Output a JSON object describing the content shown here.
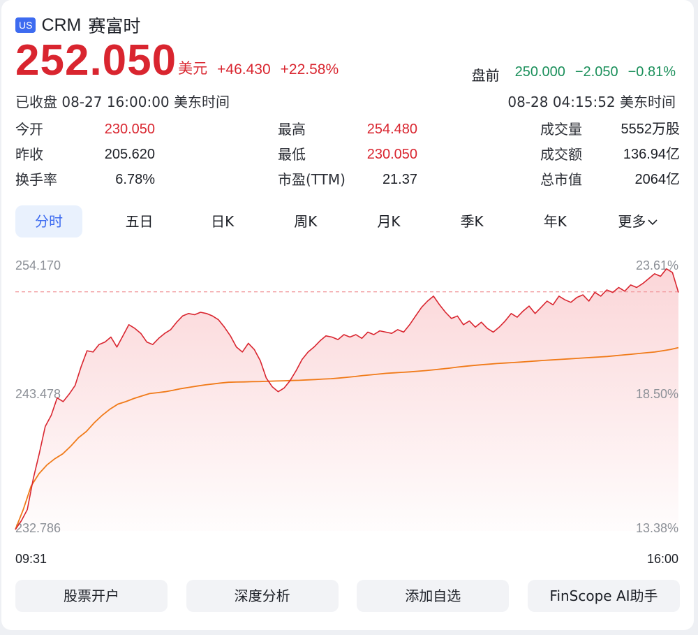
{
  "header": {
    "market_badge": "US",
    "ticker": "CRM",
    "name": "赛富时",
    "price": "252.050",
    "currency": "美元",
    "change": "+46.430",
    "change_pct": "+22.58%",
    "premarket_label": "盘前",
    "premarket_price": "250.000",
    "premarket_change": "−2.050",
    "premarket_pct": "−0.81%",
    "close_status": "已收盘 08-27 16:00:00 美东时间",
    "premarket_time": "08-28 04:15:52 美东时间"
  },
  "stats": {
    "col1": [
      {
        "label": "今开",
        "value": "230.050"
      },
      {
        "label": "昨收",
        "value": "205.620"
      },
      {
        "label": "换手率",
        "value": "6.78%"
      }
    ],
    "col2": [
      {
        "label": "最高",
        "value": "254.480"
      },
      {
        "label": "最低",
        "value": "230.050"
      },
      {
        "label": "市盈(TTM)",
        "value": "21.37"
      }
    ],
    "col3": [
      {
        "label": "成交量",
        "value": "5552万股"
      },
      {
        "label": "成交额",
        "value": "136.94亿"
      },
      {
        "label": "总市值",
        "value": "2064亿"
      }
    ]
  },
  "tabs": [
    "分时",
    "五日",
    "日K",
    "周K",
    "月K",
    "季K",
    "年K",
    "更多"
  ],
  "buttons": [
    "股票开户",
    "深度分析",
    "添加自选",
    "FinScope AI助手"
  ],
  "colors": {
    "up": "#d9252f",
    "down": "#1a8f5a",
    "accent": "#3d6bf0",
    "avg_line": "#f07a18"
  },
  "chart_data": {
    "type": "line",
    "y_ticks_left": [
      "254.170",
      "243.478",
      "232.786"
    ],
    "y_ticks_right": [
      "23.61%",
      "18.50%",
      "13.38%"
    ],
    "x_ticks": [
      "09:31",
      "16:00"
    ],
    "ylim": [
      232.786,
      254.17
    ],
    "reference_line": 252.05,
    "series": [
      {
        "values": [
          232.9,
          233.6,
          234.5,
          237.0,
          239.0,
          241.2,
          242.1,
          243.5,
          243.2,
          243.8,
          244.5,
          246.0,
          247.3,
          247.2,
          247.8,
          248.0,
          248.4,
          247.6,
          248.5,
          249.4,
          249.1,
          248.7,
          248.0,
          247.8,
          248.3,
          248.7,
          249.0,
          249.6,
          250.1,
          250.3,
          250.2,
          250.4,
          250.3,
          250.1,
          249.8,
          249.2,
          248.5,
          247.6,
          247.2,
          247.9,
          247.4,
          246.5,
          245.1,
          244.4,
          244.0,
          244.3,
          244.9,
          245.7,
          246.6,
          247.2,
          247.6,
          248.1,
          248.5,
          248.4,
          248.2,
          248.6,
          248.4,
          248.6,
          248.3,
          248.8,
          248.6,
          248.9,
          248.8,
          248.7,
          249.0,
          248.8,
          249.4,
          250.1,
          250.8,
          251.3,
          251.7,
          251.0,
          250.4,
          249.9,
          250.1,
          249.4,
          249.7,
          249.2,
          249.6,
          249.1,
          248.8,
          249.2,
          249.7,
          250.3,
          250.0,
          250.5,
          250.9,
          250.3,
          250.8,
          251.3,
          251.0,
          251.7,
          251.4,
          251.2,
          251.6,
          251.8,
          251.3,
          252.0,
          251.7,
          252.2,
          252.0,
          252.4,
          252.1,
          252.6,
          252.4,
          252.7,
          253.1,
          253.5,
          253.3,
          253.9,
          253.6,
          252.0
        ]
      },
      {
        "values": [
          232.9,
          234.5,
          236.4,
          237.4,
          238.1,
          238.6,
          239.0,
          239.6,
          240.3,
          240.8,
          241.5,
          242.1,
          242.6,
          243.0,
          243.2,
          243.45,
          243.65,
          243.85,
          243.92,
          244.0,
          244.12,
          244.25,
          244.35,
          244.45,
          244.55,
          244.62,
          244.7,
          244.76,
          244.78,
          244.79,
          244.81,
          244.82,
          244.84,
          244.86,
          244.88,
          244.9,
          244.92,
          244.95,
          244.98,
          245.02,
          245.05,
          245.1,
          245.16,
          245.22,
          245.3,
          245.36,
          245.42,
          245.48,
          245.52,
          245.56,
          245.6,
          245.65,
          245.7,
          245.76,
          245.83,
          245.9,
          245.98,
          246.05,
          246.11,
          246.17,
          246.22,
          246.27,
          246.31,
          246.35,
          246.39,
          246.43,
          246.48,
          246.52,
          246.56,
          246.6,
          246.64,
          246.68,
          246.72,
          246.76,
          246.8,
          246.84,
          246.9,
          246.96,
          247.02,
          247.08,
          247.14,
          247.2,
          247.3,
          247.4,
          247.55
        ]
      }
    ]
  }
}
